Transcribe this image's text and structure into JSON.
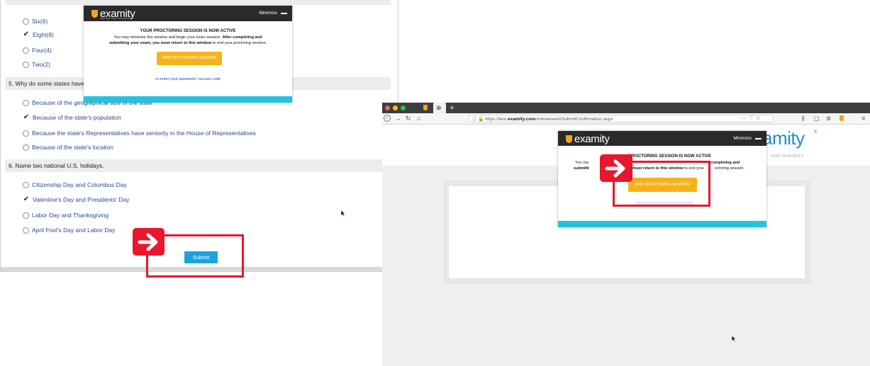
{
  "left_exam": {
    "q4_options": [
      {
        "label": "Six(6)",
        "checked": false
      },
      {
        "label": "Eight(8)",
        "checked": true
      },
      {
        "label": "Four(4)",
        "checked": false
      },
      {
        "label": "Two(2)",
        "checked": false
      }
    ],
    "q5": {
      "question": "5. Why do some states have",
      "options": [
        {
          "label": "Because of the geographical size of the state",
          "checked": false
        },
        {
          "label": "Because of the state's population",
          "checked": true
        },
        {
          "label": "Because the state's Representatives have seniority in the House of Representatives",
          "checked": false
        },
        {
          "label": "Because of the state's location",
          "checked": false
        }
      ]
    },
    "q6": {
      "question": "6. Name two national U.S. holidays.",
      "options": [
        {
          "label": "Citizenship Day and Columbus Day",
          "checked": false
        },
        {
          "label": "Valentine's Day and Presidents' Day",
          "checked": true
        },
        {
          "label": "Labor Day and Thanksgiving",
          "checked": false
        },
        {
          "label": "April Fool's Day and Labor Day",
          "checked": false
        }
      ]
    },
    "submit_label": "Submit"
  },
  "proctor_popup": {
    "brand": "examity",
    "brand_tagline": "BETTER TEST INTEGRITY.",
    "minimize_label": "Minimize",
    "title": "YOUR PROCTORING SESSION IS NOW ACTIVE",
    "msg_line1": "You may minimize this window and begin your exam session.",
    "msg_line1_bold": "After completing and",
    "msg_line2_bold": "submitting your exam, you must return to this window",
    "msg_line2": "to end your proctoring session.",
    "end_button": "END PROCTORING SESSION",
    "reenter_link": "re-enter your password / access code"
  },
  "right_browser": {
    "url_prefix": "https://test.",
    "url_domain": "examity.com",
    "url_path": "/onlineexam/SubmitConfirmation.aspx",
    "url_actions": "··· ♡ ☆",
    "page_brand": "amity",
    "page_tagline": "TEST INTEGRITY.",
    "popup": {
      "brand": "examity",
      "minimize_label": "Minimize",
      "title": "PROCTORING SESSION IS NOW ACTIVE",
      "line1_a": "You ma",
      "line1_b": "completing and",
      "line2_a": "submitti",
      "line2_b": "u must return to this window",
      "line2_c": "to end your",
      "line2_d": "octoring session.",
      "end_button": "END PROCTORING SESSION"
    }
  },
  "colors": {
    "highlight_red": "#e8172d",
    "examity_orange": "#f4a51c",
    "submit_blue": "#1aa3e0",
    "cyan_bar": "#22c3df"
  }
}
